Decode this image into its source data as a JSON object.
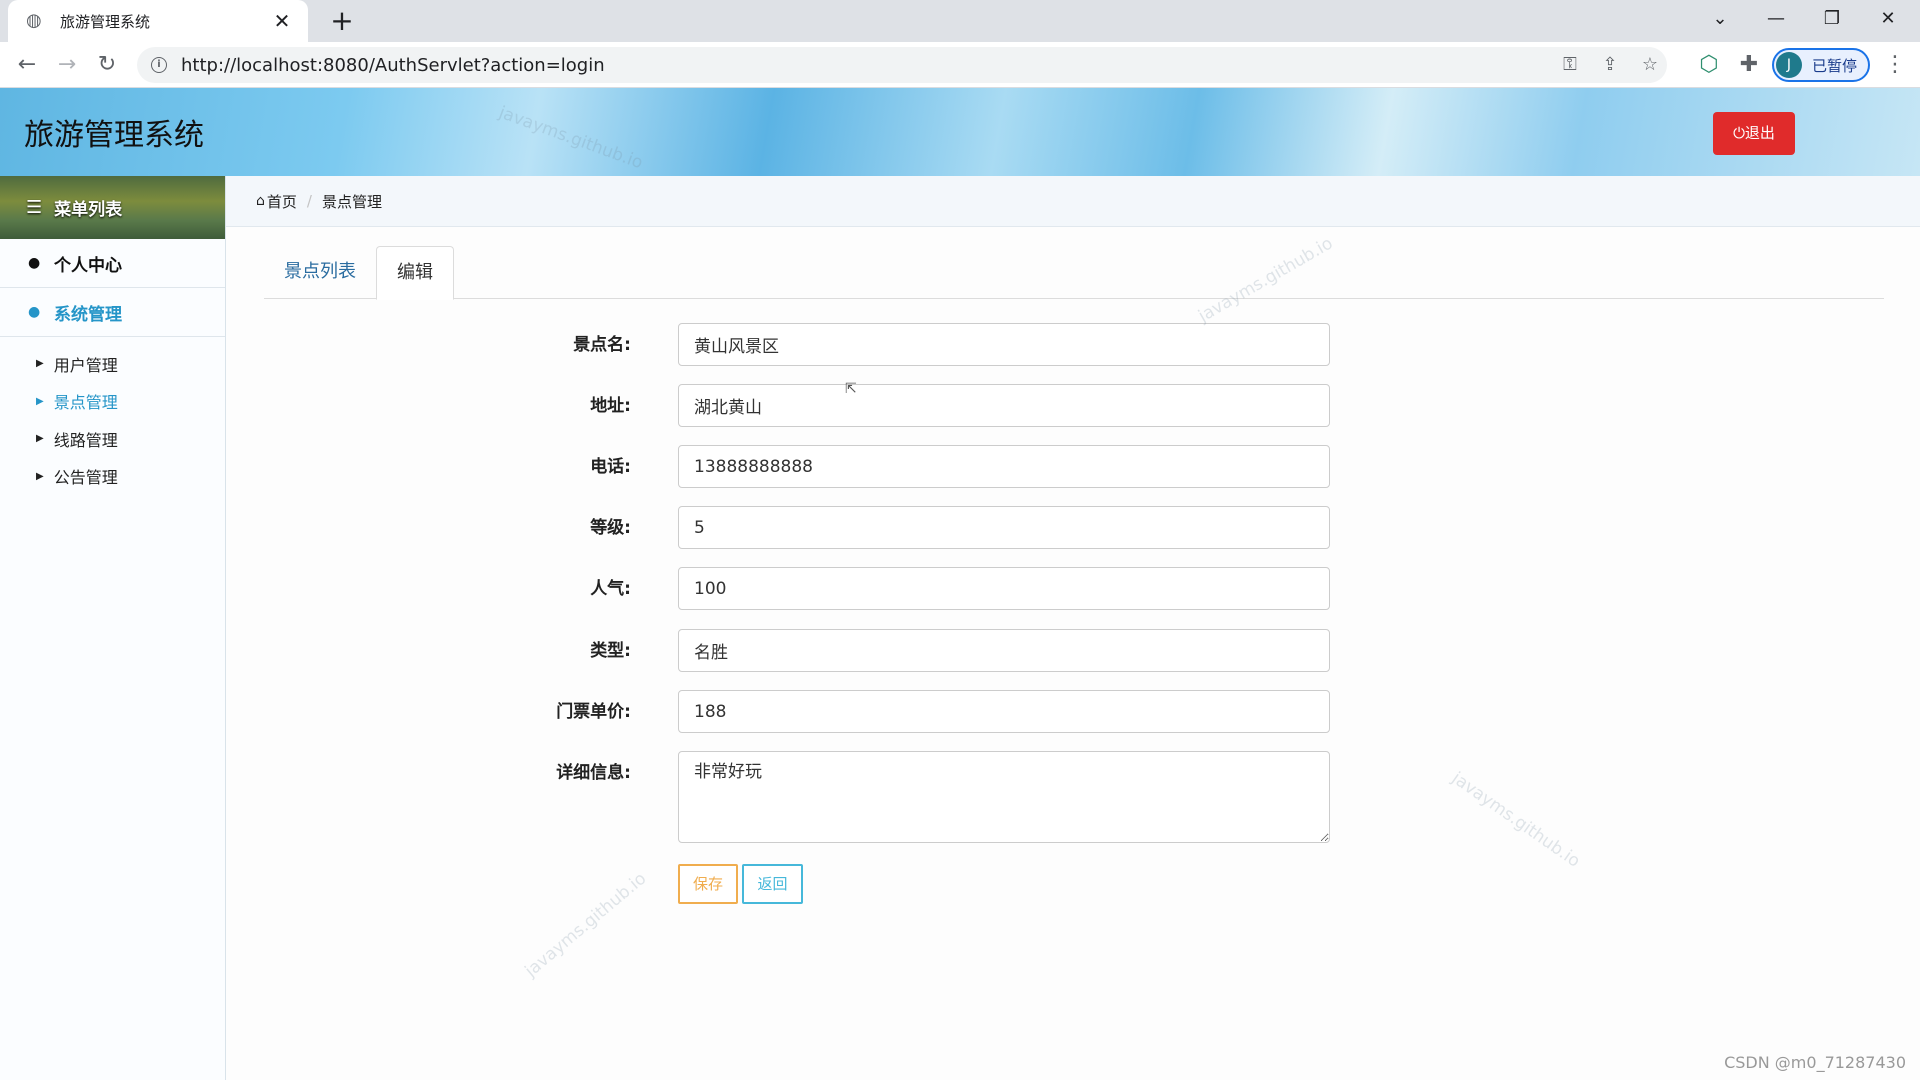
{
  "browser": {
    "tab_title": "旅游管理系统",
    "url": "http://localhost:8080/AuthServlet?action=login",
    "profile_initial": "J",
    "profile_status": "已暂停"
  },
  "header": {
    "title": "旅游管理系统",
    "logout_label": "⏻退出"
  },
  "sidebar": {
    "menu_title": "菜单列表",
    "items": [
      {
        "label": "个人中心"
      },
      {
        "label": "系统管理"
      }
    ],
    "subitems": [
      {
        "label": "用户管理"
      },
      {
        "label": "景点管理"
      },
      {
        "label": "线路管理"
      },
      {
        "label": "公告管理"
      }
    ]
  },
  "breadcrumb": {
    "home": "首页",
    "current": "景点管理"
  },
  "tabs": {
    "list_label": "景点列表",
    "edit_label": "编辑"
  },
  "form": {
    "fields": [
      {
        "label": "景点名:",
        "value": "黄山风景区"
      },
      {
        "label": "地址:",
        "value": "湖北黄山"
      },
      {
        "label": "电话:",
        "value": "13888888888"
      },
      {
        "label": "等级:",
        "value": "5"
      },
      {
        "label": "人气:",
        "value": "100"
      },
      {
        "label": "类型:",
        "value": "名胜"
      },
      {
        "label": "门票单价:",
        "value": "188"
      },
      {
        "label": "详细信息:",
        "value": "非常好玩"
      }
    ],
    "save_label": "保存",
    "back_label": "返回"
  },
  "watermark": "javayms.github.io",
  "footer_credit": "CSDN @m0_71287430"
}
